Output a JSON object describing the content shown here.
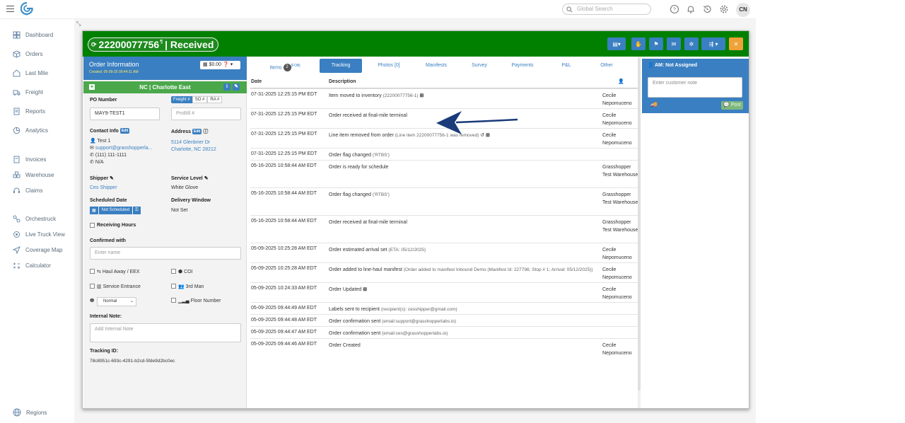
{
  "topbar": {
    "search_placeholder": "Global Search",
    "avatar": "CN"
  },
  "sidebar": {
    "items": [
      {
        "label": "Dashboard",
        "icon": "dashboard-icon"
      },
      {
        "label": "Orders",
        "icon": "cube-icon"
      },
      {
        "label": "Last Mile",
        "icon": "house-icon"
      },
      {
        "label": "Freight",
        "icon": "truck-icon"
      },
      {
        "label": "Reports",
        "icon": "report-icon"
      },
      {
        "label": "Analytics",
        "icon": "analytics-icon"
      },
      {
        "label": "Invoices",
        "icon": "invoice-icon"
      },
      {
        "label": "Warehouse",
        "icon": "warehouse-icon"
      },
      {
        "label": "Claims",
        "icon": "headset-icon"
      },
      {
        "label": "Orchestruck",
        "icon": "orchestruck-icon"
      },
      {
        "label": "Live Truck View",
        "icon": "target-icon"
      },
      {
        "label": "Coverage Map",
        "icon": "navigate-icon"
      },
      {
        "label": "Calculator",
        "icon": "calculator-icon"
      },
      {
        "label": "Regions",
        "icon": "globe-icon"
      }
    ]
  },
  "order": {
    "number": "22200077756",
    "status_sep": "| Received",
    "header_color": "#018000"
  },
  "info": {
    "title": "Order Information",
    "created": "Created: 05-09-25 09:44:11 AM",
    "amount": "$0.00",
    "terminal": "NC | Charlotte East",
    "po_label": "PO Number",
    "po_value": "MAY9-TEST1",
    "ref_tabs": [
      "Freight #",
      "SO #",
      "RA #"
    ],
    "probill_placeholder": "ProBill #",
    "contact_label": "Contact Info",
    "edit": "Edit",
    "contact_name": "Test 1",
    "contact_email": "support@grasshopperla...",
    "contact_phone": "(111) 111-1111",
    "contact_alt": "N/A",
    "address_label": "Address",
    "address_line1": "5114 Glenbrier Dr",
    "address_line2": "Charlotte, NC 28212",
    "shipper_label": "Shipper",
    "shipper_value": "Ces Shipper",
    "service_label": "Service Level",
    "service_value": "White Glove",
    "sched_label": "Scheduled Date",
    "sched_value": "Not Scheduled",
    "window_label": "Delivery Window",
    "window_value": "Not Set",
    "receiving_hours": "Receiving Hours",
    "confirmed_label": "Confirmed with",
    "confirmed_placeholder": "Enter name",
    "haul_away": "Haul Away / EEX",
    "coi": "COI",
    "service_entrance": "Service Entrance",
    "third_man": "3rd Man",
    "priority": "Normal",
    "floor_number": "Floor Number",
    "internal_label": "Internal Note:",
    "internal_placeholder": "Add Internal Note",
    "tracking_label": "Tracking ID:",
    "tracking_value": "78c8951c-693c-4291-b2cd-5fde9d2bc0ec"
  },
  "tabs": [
    {
      "label": "Items",
      "badge": "2",
      "sup": "[FOB]"
    },
    {
      "label": "Tracking"
    },
    {
      "label": "Photos [0]"
    },
    {
      "label": "Manifests"
    },
    {
      "label": "Survey"
    },
    {
      "label": "Payments"
    },
    {
      "label": "P&L"
    },
    {
      "label": "Other"
    }
  ],
  "tracking": {
    "col_date": "Date",
    "col_desc": "Description",
    "rows": [
      {
        "date": "07-31-2025 12:25:15 PM EDT",
        "desc": "Item moved to inventory",
        "detail": "(22200077756-1)",
        "user": "Cecile Nepomuceno"
      },
      {
        "date": "07-31-2025 12:25:15 PM EDT",
        "desc": "Order received at final-mile terminal",
        "detail": "",
        "user": "Cecile Nepomuceno"
      },
      {
        "date": "07-31-2025 12:25:15 PM EDT",
        "desc": "Line item removed from order",
        "detail": "(Line item 22200077756-1 was removed)",
        "user": "Cecile Nepomuceno"
      },
      {
        "date": "07-31-2025 12:25:15 PM EDT",
        "desc": "Order flag changed",
        "detail": "('RTBS')",
        "user": ""
      },
      {
        "date": "05-16-2025 10:58:44 AM EDT",
        "desc": "Order is ready for schedule",
        "detail": "",
        "user": "Grasshopper Test Warehouse"
      },
      {
        "date": "05-16-2025 10:58:44 AM EDT",
        "desc": "Order flag changed",
        "detail": "('RTBS')",
        "user": "Grasshopper Test Warehouse"
      },
      {
        "date": "05-16-2025 10:58:44 AM EDT",
        "desc": "Order received at final-mile terminal",
        "detail": "",
        "user": "Grasshopper Test Warehouse"
      },
      {
        "date": "05-09-2025 10:25:28 AM EDT",
        "desc": "Order estimated arrival set",
        "detail": "(ETA: 05/12/2025)",
        "user": "Cecile Nepomuceno"
      },
      {
        "date": "05-09-2025 10:25:28 AM EDT",
        "desc": "Order added to line-haul manifest",
        "detail": "(Order added to manifest Inbound Demo (Manifest Id: 227796; Stop # 1; Arrival: 05/12/2025))",
        "user": "Cecile Nepomuceno"
      },
      {
        "date": "05-09-2025 10:24:33 AM EDT",
        "desc": "Order Updated",
        "detail": "",
        "user": "Cecile Nepomuceno"
      },
      {
        "date": "05-09-2025 09:44:49 AM EDT",
        "desc": "Labels sent to recipient",
        "detail": "(recipient(s): cesshipper@gmail.com)",
        "user": ""
      },
      {
        "date": "05-09-2025 09:44:48 AM EDT",
        "desc": "Order confirmation sent",
        "detail": "(email:support@grasshopperlabs.io)",
        "user": ""
      },
      {
        "date": "05-09-2025 09:44:47 AM EDT",
        "desc": "Order confirmation sent",
        "detail": "(email:ces@grasshopperlabs.io)",
        "user": ""
      },
      {
        "date": "05-09-2025 09:44:46 AM EDT",
        "desc": "Order Created",
        "detail": "",
        "user": "Cecile Nepomuceno"
      }
    ]
  },
  "rightpanel": {
    "am_label": "AM: Not Assigned",
    "note_placeholder": "Enter customer note",
    "post": "Post"
  }
}
